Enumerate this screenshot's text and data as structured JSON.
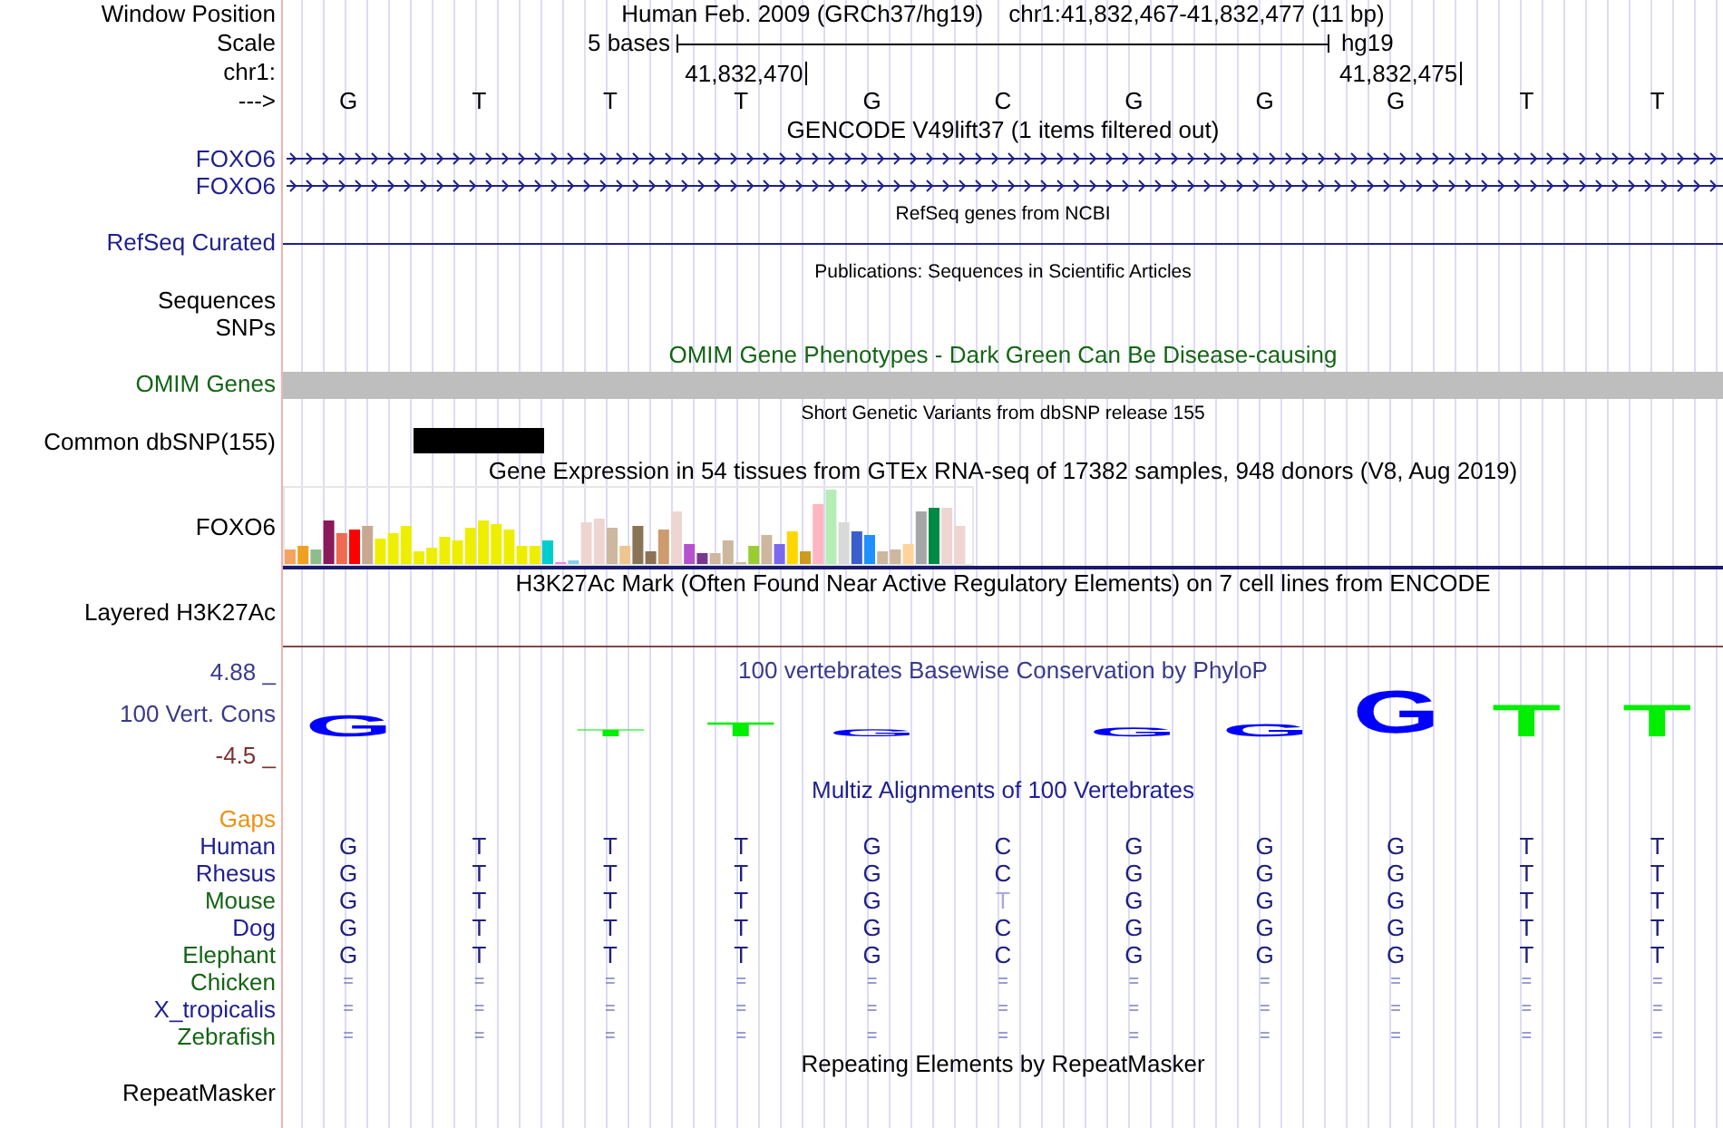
{
  "header": {
    "label": "Window Position",
    "title": "Human Feb. 2009 (GRCh37/hg19)",
    "position": "chr1:41,832,467-41,832,477 (11 bp)"
  },
  "scale": {
    "label": "Scale",
    "span": "5 bases",
    "assembly": "hg19"
  },
  "coordinates": {
    "label": "chr1:",
    "ticks": [
      "41,832,470",
      "41,832,475"
    ]
  },
  "sequence": {
    "label": "--->",
    "bases": [
      "G",
      "T",
      "T",
      "T",
      "G",
      "C",
      "G",
      "G",
      "G",
      "T",
      "T"
    ]
  },
  "tracks": [
    {
      "kind": "caption",
      "text": "GENCODE V49lift37 (1 items filtered out)"
    },
    {
      "kind": "gene",
      "label": "FOXO6",
      "color": "#1f1f8f"
    },
    {
      "kind": "gene",
      "label": "FOXO6",
      "color": "#1f1f8f"
    },
    {
      "kind": "subcaption",
      "text": "RefSeq genes from NCBI"
    },
    {
      "kind": "line",
      "label": "RefSeq Curated",
      "color": "#1f1f8f"
    },
    {
      "kind": "subcaption",
      "text": "Publications: Sequences in Scientific Articles"
    },
    {
      "kind": "empty",
      "label": "Sequences"
    },
    {
      "kind": "empty",
      "label": "SNPs"
    },
    {
      "kind": "caption",
      "text": "OMIM Gene Phenotypes - Dark Green Can Be Disease-causing",
      "color": "#146414"
    },
    {
      "kind": "bar",
      "label": "OMIM Genes",
      "color": "#146414"
    },
    {
      "kind": "subcaption",
      "text": "Short Genetic Variants from dbSNP release 155"
    },
    {
      "kind": "snp",
      "label": "Common dbSNP(155)"
    },
    {
      "kind": "caption",
      "text": "Gene Expression in 54 tissues from GTEx RNA-seq of 17382 samples, 948 donors (V8, Aug 2019)"
    },
    {
      "kind": "expression",
      "label": "FOXO6"
    },
    {
      "kind": "caption",
      "text": "H3K27Ac Mark (Often Found Near Active Regulatory Elements) on 7 cell lines from ENCODE"
    },
    {
      "kind": "signal",
      "label": "Layered H3K27Ac"
    },
    {
      "kind": "conservation",
      "label": "100 Vert. Cons",
      "color": "#3a3a8a",
      "text": "100 vertebrates Basewise Conservation by PhyloP",
      "upper": "4.88 _",
      "lower": "-4.5 _",
      "logo": [
        {
          "kind": "letter",
          "base": "G",
          "color": "#0000ff"
        },
        {
          "kind": "blank"
        },
        {
          "kind": "letter",
          "base": "T",
          "color": "#00ee00"
        },
        {
          "kind": "letter",
          "base": "T",
          "color": "#00ee00"
        },
        {
          "kind": "letter",
          "base": "G",
          "color": "#0000ff"
        },
        {
          "kind": "blank"
        },
        {
          "kind": "letter",
          "base": "G",
          "color": "#0000ff"
        },
        {
          "kind": "letter",
          "base": "G",
          "color": "#0000ff"
        },
        {
          "kind": "letter",
          "base": "G",
          "color": "#0000ff"
        },
        {
          "kind": "letter",
          "base": "T",
          "color": "#00ee00"
        },
        {
          "kind": "letter",
          "base": "T",
          "color": "#00ee00"
        }
      ]
    },
    {
      "kind": "caption",
      "text": "Multiz Alignments of 100 Vertebrates",
      "color": "#1f1f8f"
    },
    {
      "kind": "empty",
      "label": "Gaps",
      "color": "#f09010"
    },
    {
      "kind": "alignment",
      "label": "Human",
      "color": "#1f1f8f",
      "aligned": true,
      "bases": [
        "G",
        "T",
        "T",
        "T",
        "G",
        "C",
        "G",
        "G",
        "G",
        "T",
        "T"
      ]
    },
    {
      "kind": "alignment",
      "label": "Rhesus",
      "color": "#1f1f8f",
      "aligned": true,
      "bases": [
        "G",
        "T",
        "T",
        "T",
        "G",
        "C",
        "G",
        "G",
        "G",
        "T",
        "T"
      ]
    },
    {
      "kind": "alignment",
      "label": "Mouse",
      "color": "#146414",
      "aligned": true,
      "bases": [
        "G",
        "T",
        "T",
        "T",
        "G",
        "T",
        "G",
        "G",
        "G",
        "T",
        "T"
      ],
      "mismatch": [
        false,
        false,
        false,
        false,
        false,
        true,
        false,
        false,
        false,
        false,
        false
      ]
    },
    {
      "kind": "alignment",
      "label": "Dog",
      "color": "#1f1f8f",
      "aligned": true,
      "bases": [
        "G",
        "T",
        "T",
        "T",
        "G",
        "C",
        "G",
        "G",
        "G",
        "T",
        "T"
      ]
    },
    {
      "kind": "alignment",
      "label": "Elephant",
      "color": "#146414",
      "aligned": true,
      "bases": [
        "G",
        "T",
        "T",
        "T",
        "G",
        "C",
        "G",
        "G",
        "G",
        "T",
        "T"
      ]
    },
    {
      "kind": "alignment",
      "label": "Chicken",
      "color": "#146414",
      "aligned": false,
      "bases": [
        "=",
        "=",
        "=",
        "=",
        "=",
        "=",
        "=",
        "=",
        "=",
        "=",
        "="
      ]
    },
    {
      "kind": "alignment",
      "label": "X_tropicalis",
      "color": "#1f1f8f",
      "aligned": false,
      "bases": [
        "=",
        "=",
        "=",
        "=",
        "=",
        "=",
        "=",
        "=",
        "=",
        "=",
        "="
      ]
    },
    {
      "kind": "alignment",
      "label": "Zebrafish",
      "color": "#146414",
      "aligned": false,
      "bases": [
        "=",
        "=",
        "=",
        "=",
        "=",
        "=",
        "=",
        "=",
        "=",
        "=",
        "="
      ]
    },
    {
      "kind": "caption",
      "text": "Repeating Elements by RepeatMasker"
    },
    {
      "kind": "empty",
      "label": "RepeatMasker"
    }
  ]
}
